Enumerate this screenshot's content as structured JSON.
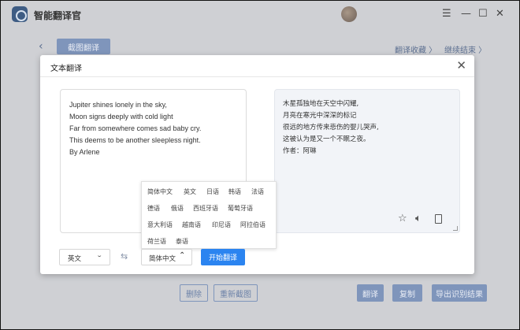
{
  "app": {
    "title": "智能翻译官",
    "text_tab": "截图翻译",
    "link_favorites": "翻译收藏 〉",
    "link_continue": "继续结束 〉",
    "window_controls": {
      "menu": "☰",
      "minimize": "—",
      "maximize": "☐",
      "close": "✕"
    },
    "back_icon": "‹",
    "bottom_buttons": {
      "delete": "删除",
      "recapture": "重新截图",
      "translate": "翻译",
      "copy": "复制",
      "export": "导出识别结果"
    }
  },
  "dialog": {
    "title": "文本翻译",
    "close_icon": "✕",
    "source_text": "Jupiter shines lonely in the sky,\nMoon signs deeply with cold light\nFar from somewhere comes sad baby cry.\nThis deems to be another sleepless night.\nBy Arlene",
    "result_text": "木星孤独地在天空中闪耀,\n月亮在寒光中深深的标记\n很远的地方传来悲伤的婴儿哭声,\n这被认为是又一个不眠之夜。\n作者：阿琳",
    "result_icons": {
      "star": "☆",
      "sound": "🔈︎"
    },
    "source_language": "英文",
    "target_language": "简体中文",
    "source_chevron": "⌄",
    "target_chevron": "⌃",
    "swap_icon": "⇆",
    "start_button": "开始翻译",
    "language_options": [
      "简体中文",
      "英文",
      "日语",
      "韩语",
      "法语",
      "德语",
      "俄语",
      "西班牙语",
      "葡萄牙语",
      "意大利语",
      "越南语",
      "印尼语",
      "阿拉伯语",
      "荷兰语",
      "泰语"
    ]
  }
}
